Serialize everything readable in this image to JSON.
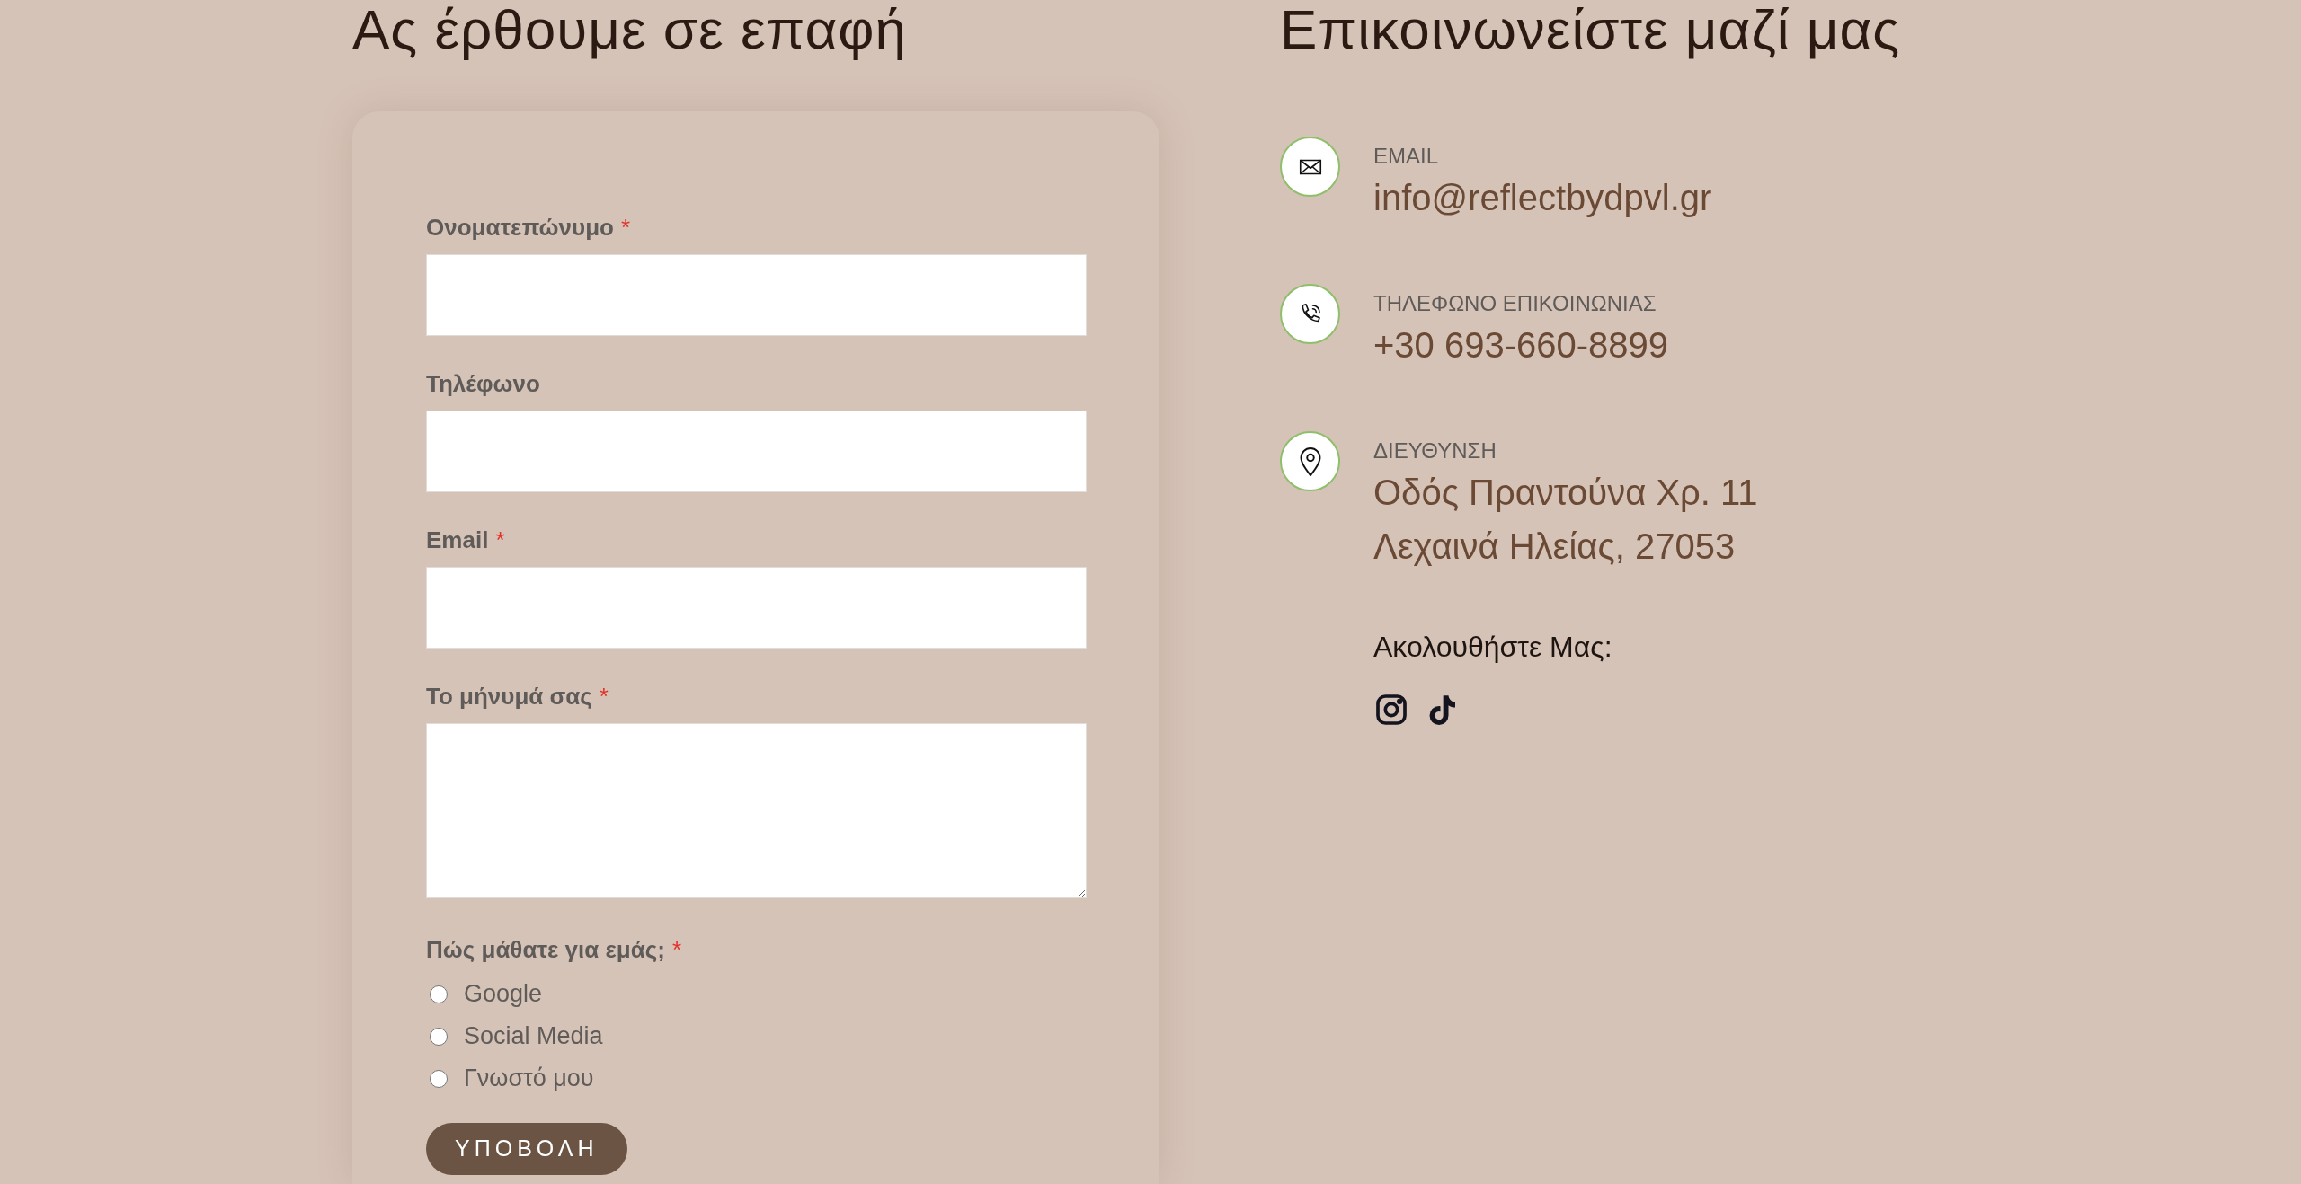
{
  "form_section": {
    "title": "Ας έρθουμε σε επαφή",
    "fields": [
      {
        "kind": "input",
        "label": "Ονοματεπώνυμο",
        "required_mark": "*"
      },
      {
        "kind": "input",
        "label": "Τηλέφωνο"
      },
      {
        "kind": "input",
        "label": "Email",
        "required_mark": "*"
      },
      {
        "kind": "textarea",
        "label": "Το μήνυμά σας",
        "required_mark": "*"
      }
    ],
    "question": {
      "label": "Πώς μάθατε για εμάς;",
      "required_mark": "*",
      "options": [
        {
          "label": "Google",
          "selected": false
        },
        {
          "label": "Social Media",
          "selected": false
        },
        {
          "label": "Γνωστό μου",
          "selected": false
        }
      ]
    },
    "submit": "ΥΠΟΒΟΛΗ"
  },
  "contact_section": {
    "title": "Επικοινωνείστε μαζί μας",
    "items": [
      {
        "kind": "email",
        "label": "EMAIL",
        "lines": [
          "info@reflectbydpvl.gr"
        ]
      },
      {
        "kind": "phone",
        "label": "ΤΗΛΕΦΩΝΟ ΕΠΙΚΟΙΝΩΝΙΑΣ",
        "lines": [
          "+30 693-660-8899"
        ]
      },
      {
        "kind": "address",
        "label": "ΔΙΕΥΘΥΝΣΗ",
        "lines": [
          "Οδός Πραντούνα Χρ. 11",
          "Λεχαινά Ηλείας, 27053"
        ]
      }
    ],
    "follow_label": "Ακολουθήστε Μας:",
    "socials": [
      {
        "kind": "instagram"
      },
      {
        "kind": "tiktok"
      }
    ]
  }
}
